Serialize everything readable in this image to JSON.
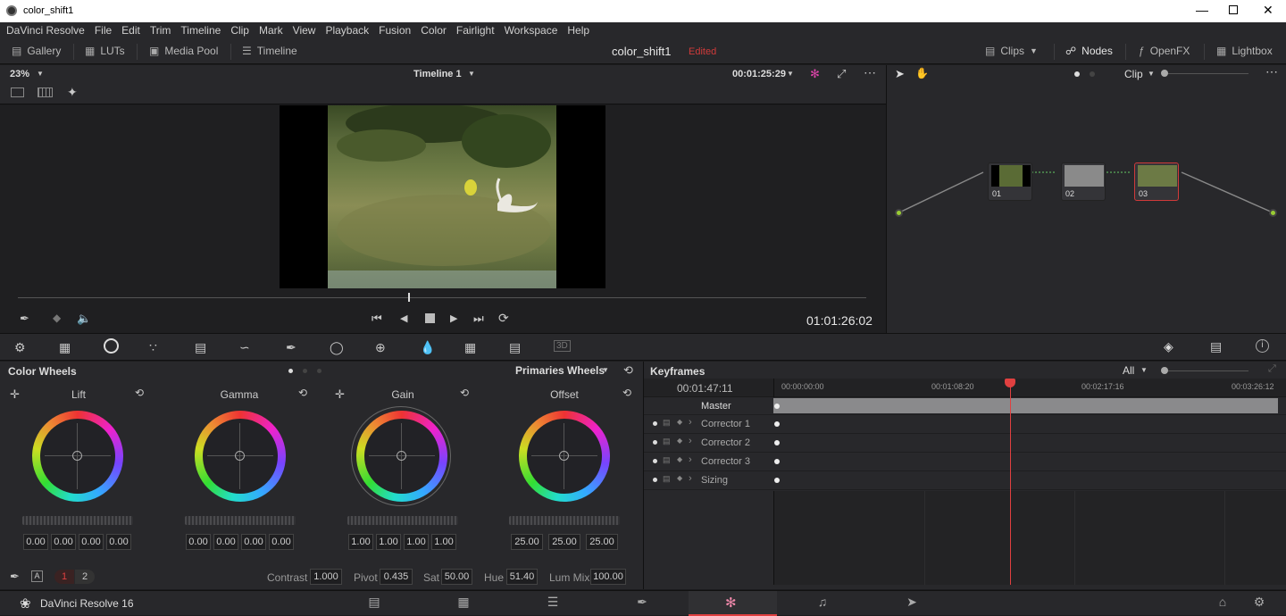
{
  "window": {
    "title": "color_shift1"
  },
  "menu": [
    "DaVinci Resolve",
    "File",
    "Edit",
    "Trim",
    "Timeline",
    "Clip",
    "Mark",
    "View",
    "Playback",
    "Fusion",
    "Color",
    "Fairlight",
    "Workspace",
    "Help"
  ],
  "toolbar": {
    "gallery": "Gallery",
    "luts": "LUTs",
    "media_pool": "Media Pool",
    "timeline": "Timeline",
    "project": "color_shift1",
    "status": "Edited",
    "clips": "Clips",
    "nodes": "Nodes",
    "openfx": "OpenFX",
    "lightbox": "Lightbox"
  },
  "viewer": {
    "zoom": "23%",
    "timeline_name": "Timeline 1",
    "timecode_top": "00:01:25:29",
    "timecode": "01:01:26:02",
    "progress": 0.46
  },
  "nodes_panel": {
    "mode": "Clip",
    "nodes": [
      "01",
      "02",
      "03"
    ]
  },
  "color_wheels": {
    "title": "Color Wheels",
    "mode": "Primaries Wheels",
    "wheels": [
      {
        "name": "Lift",
        "values": [
          "0.00",
          "0.00",
          "0.00",
          "0.00"
        ]
      },
      {
        "name": "Gamma",
        "values": [
          "0.00",
          "0.00",
          "0.00",
          "0.00"
        ]
      },
      {
        "name": "Gain",
        "values": [
          "1.00",
          "1.00",
          "1.00",
          "1.00"
        ]
      },
      {
        "name": "Offset",
        "values": [
          "25.00",
          "25.00",
          "25.00"
        ]
      }
    ],
    "page1": "1",
    "page2": "2",
    "contrast_label": "Contrast",
    "contrast": "1.000",
    "pivot_label": "Pivot",
    "pivot": "0.435",
    "sat_label": "Sat",
    "sat": "50.00",
    "hue_label": "Hue",
    "hue": "51.40",
    "lummix_label": "Lum Mix",
    "lummix": "100.00"
  },
  "keyframes": {
    "title": "Keyframes",
    "filter": "All",
    "timecode": "00:01:47:11",
    "ruler": [
      "00:00:00:00",
      "00:01:08:20",
      "00:02:17:16",
      "00:03:26:12"
    ],
    "rows": [
      "Master",
      "Corrector 1",
      "Corrector 2",
      "Corrector 3",
      "Sizing"
    ]
  },
  "bottom": {
    "app": "DaVinci Resolve 16"
  },
  "colors": {
    "accent_red": "#e04040",
    "edited_red": "#d03a3a"
  }
}
